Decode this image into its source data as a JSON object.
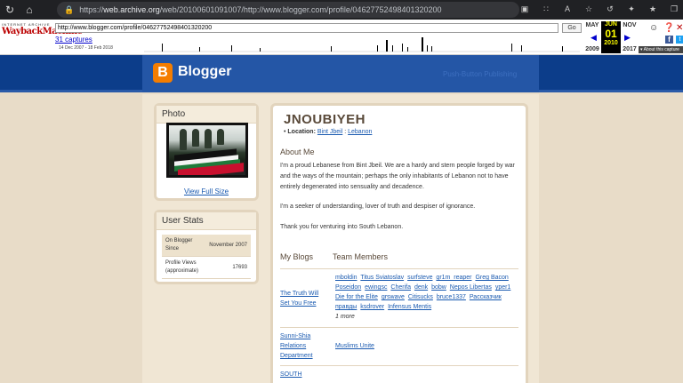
{
  "browser": {
    "url_prefix": "https://",
    "url_host": "web.archive.org",
    "url_path": "/web/20100601091007/http://www.blogger.com/profile/04627752498401320200"
  },
  "wayback": {
    "ia_label": "INTERNET ARCHIVE",
    "wm_label": "WaybackMachine",
    "url_value": "http://www.blogger.com/profile/04627752498401320200",
    "go_label": "Go",
    "captures": "31 captures",
    "range": "14 Dec 2007 - 18 Feb 2018",
    "prev_month": "MAY",
    "cur_month": "JUN",
    "next_month": "NOV",
    "prev_year": "2009",
    "cur_day": "01",
    "cur_year": "2010",
    "next_year": "2017",
    "about": "About this capture"
  },
  "blogger": {
    "logo_letter": "B",
    "name": "Blogger",
    "tagline": "Push-Button Publishing"
  },
  "photo": {
    "title": "Photo",
    "view_full": "View Full Size"
  },
  "stats": {
    "title": "User Stats",
    "rows": [
      {
        "label": "On Blogger Since",
        "value": "November 2007"
      },
      {
        "label": "Profile Views (approximate)",
        "value": "17693"
      }
    ]
  },
  "profile": {
    "name": "JNOUBIYEH",
    "location_label": "Location:",
    "city": "Bint Jbeil",
    "separator": ":",
    "country": "Lebanon",
    "about_title": "About Me",
    "about_p1": "I'm a proud Lebanese from Bint Jbeil. We are a hardy and stern people forged by war and the ways of the mountain; perhaps the only inhabitants of Lebanon not to have entirely degenerated into sensuality and decadence.",
    "about_p2": "I'm a seeker of understanding, lover of truth and despiser of ignorance.",
    "about_p3": "Thank you for venturing into South Lebanon.",
    "my_blogs_title": "My Blogs",
    "team_title": "Team Members"
  },
  "blogs": [
    {
      "name": "The Truth Will Set You Free",
      "members": [
        "mboldin",
        "Titus Sviatoslav",
        "surfsteve",
        "gr1m_reaper",
        "Greg Bacon",
        "Poseidon",
        "ewingsc",
        "Cherifa",
        "denk",
        "bobw",
        "Nepos Libertas",
        "yper1",
        "Die for the Elite",
        "grswave",
        "Citisucks",
        "bruce1337",
        "Рассказчик правды",
        "ksdrover",
        "Infensus Mentis"
      ],
      "more": "1 more"
    },
    {
      "name": "Sunni-Shia Relations Department",
      "members": [
        "Muslims Unite"
      ],
      "more": ""
    },
    {
      "name": "SOUTH",
      "members": [],
      "more": ""
    }
  ]
}
